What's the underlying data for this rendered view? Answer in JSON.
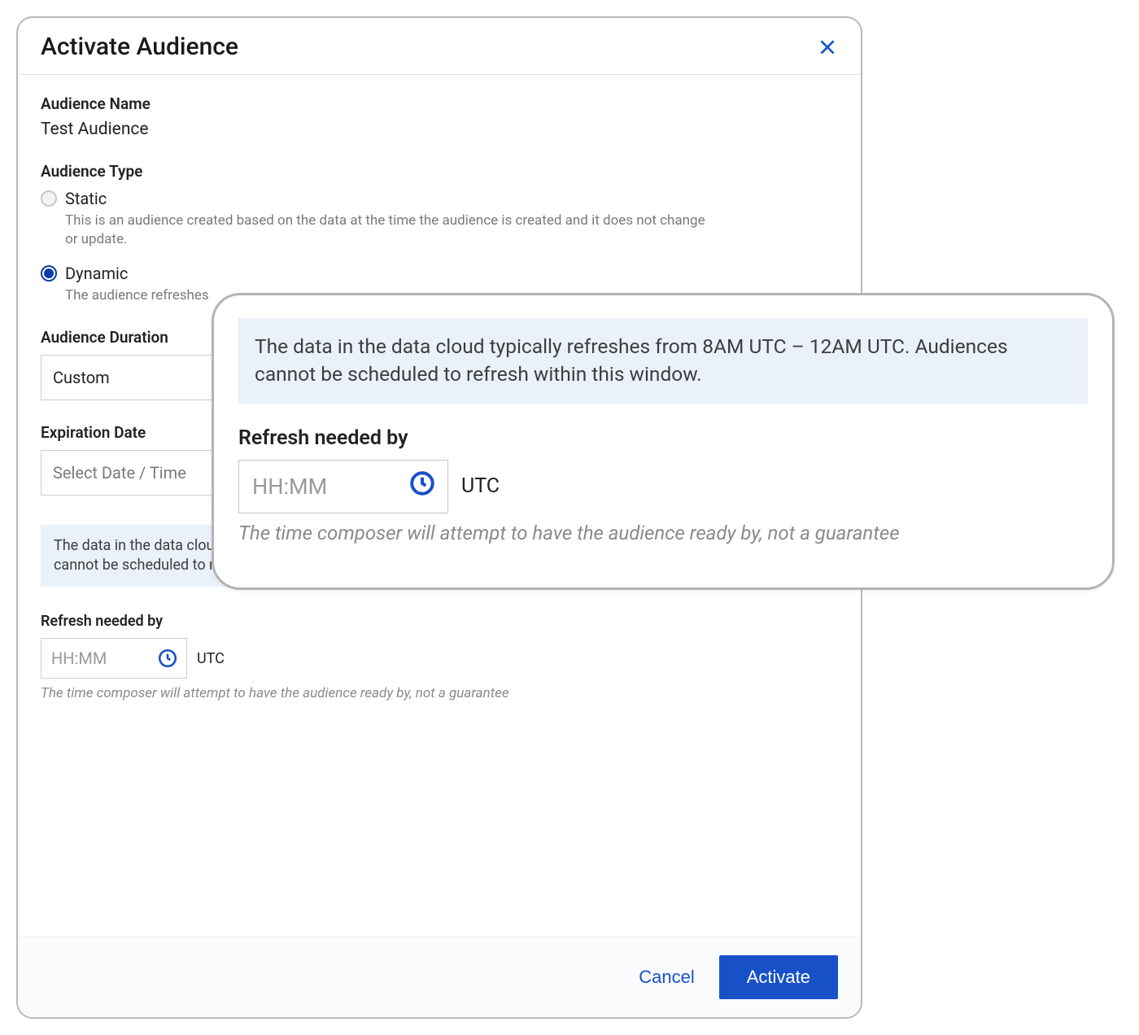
{
  "header": {
    "title": "Activate Audience"
  },
  "fields": {
    "audience_name_label": "Audience Name",
    "audience_name_value": "Test Audience",
    "audience_type_label": "Audience Type",
    "static_label": "Static",
    "static_help": "This is an audience created based on the data at the time the audience is created and it does not change or update.",
    "dynamic_label": "Dynamic",
    "dynamic_help": "The audience refreshes",
    "duration_label": "Audience Duration",
    "duration_value": "Custom",
    "expiration_label": "Expiration Date",
    "expiration_placeholder": "Select Date / Time"
  },
  "refresh_info": {
    "banner": "The data in the data cloud typically refreshes from 8AM UTC – 12AM UTC. Audiences cannot be scheduled to refresh within this window.",
    "label": "Refresh needed by",
    "time_placeholder": "HH:MM",
    "timezone": "UTC",
    "hint": "The time composer will attempt to have the audience ready by, not a guarantee"
  },
  "footer": {
    "cancel": "Cancel",
    "activate": "Activate"
  }
}
